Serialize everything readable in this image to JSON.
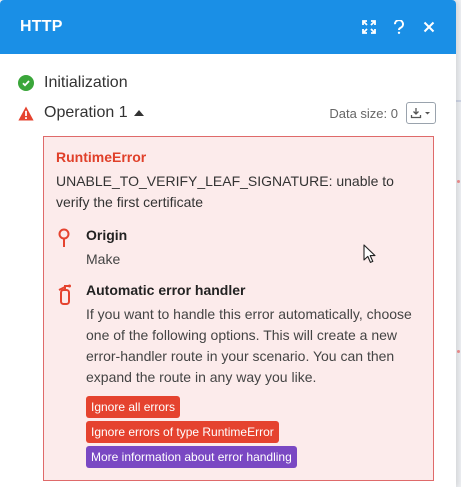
{
  "header": {
    "title": "HTTP",
    "color": "#1a8fe6"
  },
  "steps": {
    "initialization": {
      "label": "Initialization"
    },
    "operation": {
      "label": "Operation 1",
      "data_size_label": "Data size: 0"
    }
  },
  "error": {
    "title": "RuntimeError",
    "message": "UNABLE_TO_VERIFY_LEAF_SIGNATURE: unable to verify the first certificate",
    "origin": {
      "title": "Origin",
      "value": "Make"
    },
    "handler": {
      "title": "Automatic error handler",
      "text": "If you want to handle this error automatically, choose one of the following options. This will create a new error-handler route in your scenario. You can then expand the route in any way you like."
    },
    "actions": [
      {
        "label": "Ignore all errors",
        "color": "#e5432f"
      },
      {
        "label": "Ignore errors of type RuntimeError",
        "color": "#e5432f"
      },
      {
        "label": "More information about error handling",
        "color": "#7a48c3"
      }
    ]
  }
}
